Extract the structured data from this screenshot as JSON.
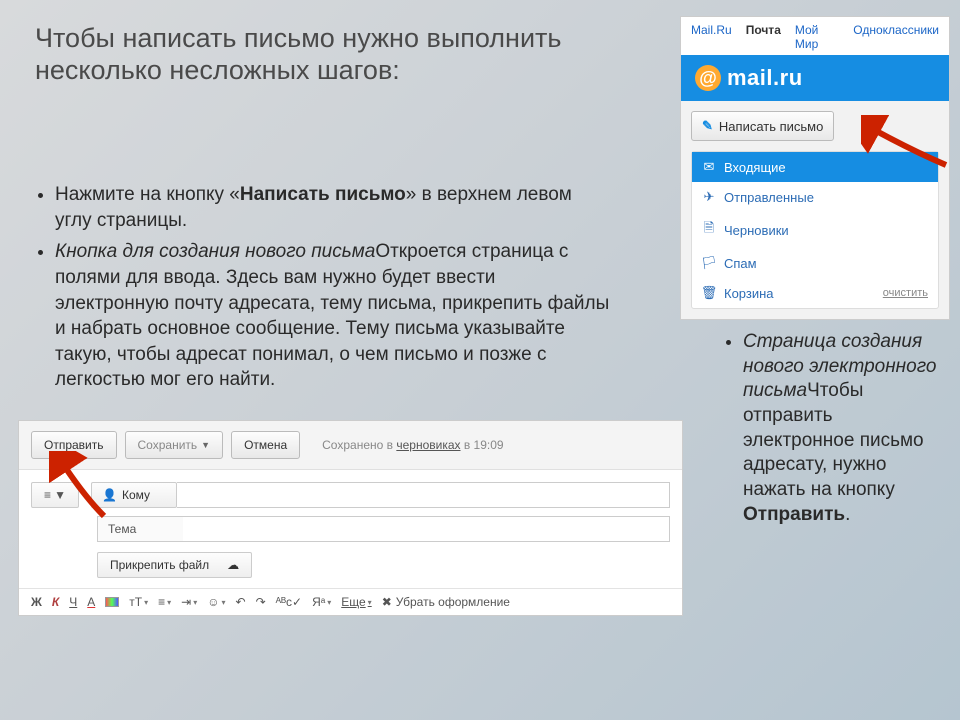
{
  "title": "Чтобы написать письмо нужно выполнить несколько несложных шагов:",
  "bullet1_a": "Нажмите на кнопку «",
  "bullet1_b": "Написать письмо",
  "bullet1_c": "» в верхнем левом углу страницы.",
  "bullet2_a": "Кнопка для создания нового письма",
  "bullet2_b": "Откроется страница с полями для ввода. Здесь вам нужно будет ввести электронную почту адресата, тему письма, прикрепить файлы и набрать основное сообщение. Тему письма указывайте такую, чтобы адресат понимал, о чем письмо и позже с легкостью мог его найти.",
  "rightnote_a": "Страница создания нового электронного письма",
  "rightnote_b": "Чтобы отправить электронное письмо адресату, нужно нажать на кнопку ",
  "rightnote_c": "Отправить",
  "rightnote_d": ".",
  "mail": {
    "topnav": {
      "brand": "Mail.Ru",
      "mail": "Почта",
      "my": "Мой Мир",
      "ok": "Одноклассники"
    },
    "at": "@",
    "logo": "mail.ru",
    "compose_label": "Написать письмо",
    "folders": {
      "inbox": "Входящие",
      "sent": "Отправленные",
      "drafts": "Черновики",
      "spam": "Спам",
      "trash": "Корзина",
      "clear": "очистить"
    }
  },
  "compose": {
    "send": "Отправить",
    "save": "Сохранить",
    "cancel": "Отмена",
    "saved_a": "Сохранено в ",
    "saved_b": "черновиках",
    "saved_c": " в 19:09",
    "to": "Кому",
    "subject": "Тема",
    "attach": "Прикрепить файл",
    "format": {
      "bold": "Ж",
      "italic": "К",
      "underline": "Ч",
      "color": "А",
      "size": "тТ",
      "more": "Еще",
      "remove": "Убрать оформление"
    }
  }
}
